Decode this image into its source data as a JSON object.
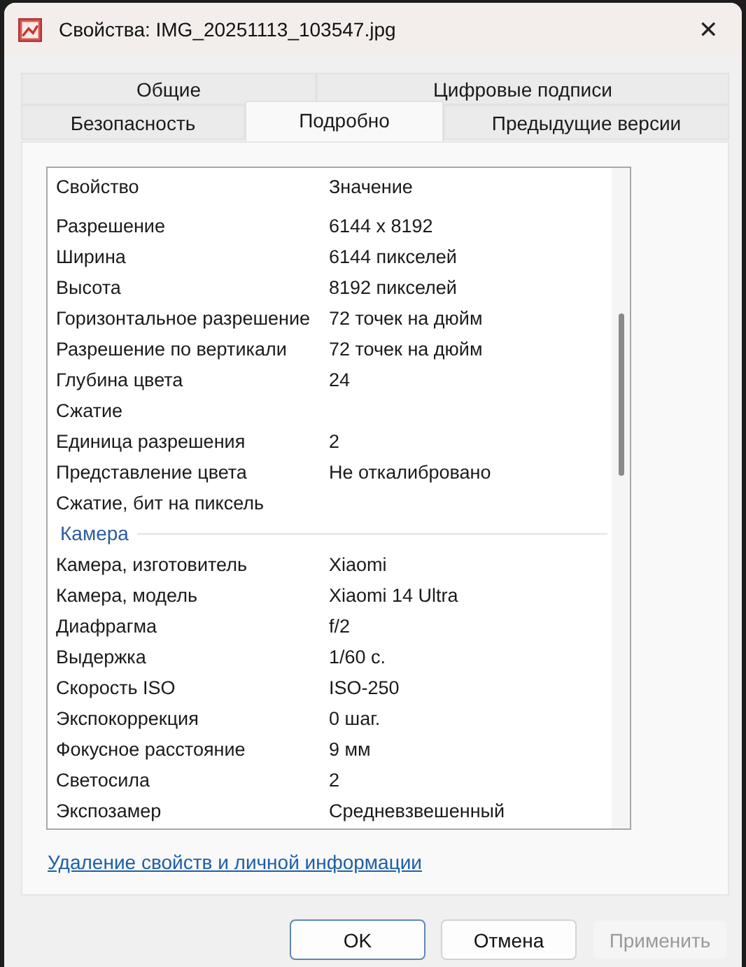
{
  "window": {
    "title": "Свойства: IMG_20251113_103547.jpg",
    "close": "✕"
  },
  "tab_rows": [
    [
      {
        "label": "Общие",
        "selected": false
      },
      {
        "label": "Цифровые подписи",
        "selected": false
      }
    ],
    [
      {
        "label": "Безопасность",
        "selected": false
      },
      {
        "label": "Подробно",
        "selected": true
      },
      {
        "label": "Предыдущие версии",
        "selected": false
      }
    ]
  ],
  "details": {
    "columns": [
      "Свойство",
      "Значение"
    ],
    "sections": [
      {
        "rows": [
          [
            "Разрешение",
            "6144 x 8192"
          ],
          [
            "Ширина",
            "6144 пикселей"
          ],
          [
            "Высота",
            "8192 пикселей"
          ],
          [
            "Горизонтальное разрешение",
            "72 точек на дюйм"
          ],
          [
            "Разрешение по вертикали",
            "72 точек на дюйм"
          ],
          [
            "Глубина цвета",
            "24"
          ],
          [
            "Сжатие",
            ""
          ],
          [
            "Единица разрешения",
            "2"
          ],
          [
            "Представление цвета",
            "Не откалибровано"
          ],
          [
            "Сжатие, бит на пиксель",
            ""
          ]
        ]
      },
      {
        "title": "Камера",
        "rows": [
          [
            "Камера, изготовитель",
            "Xiaomi"
          ],
          [
            "Камера, модель",
            "Xiaomi 14 Ultra"
          ],
          [
            "Диафрагма",
            "f/2"
          ],
          [
            "Выдержка",
            "1/60 с."
          ],
          [
            "Скорость ISO",
            "ISO-250"
          ],
          [
            "Экспокоррекция",
            "0 шаг."
          ],
          [
            "Фокусное расстояние",
            "9 мм"
          ],
          [
            "Светосила",
            "2"
          ],
          [
            "Экспозамер",
            "Средневзвешенный"
          ]
        ]
      }
    ]
  },
  "link": "Удаление свойств и личной информации",
  "buttons": [
    {
      "label": "OK",
      "default": true,
      "disabled": false
    },
    {
      "label": "Отмена",
      "default": false,
      "disabled": false
    },
    {
      "label": "Применить",
      "default": false,
      "disabled": true
    }
  ]
}
